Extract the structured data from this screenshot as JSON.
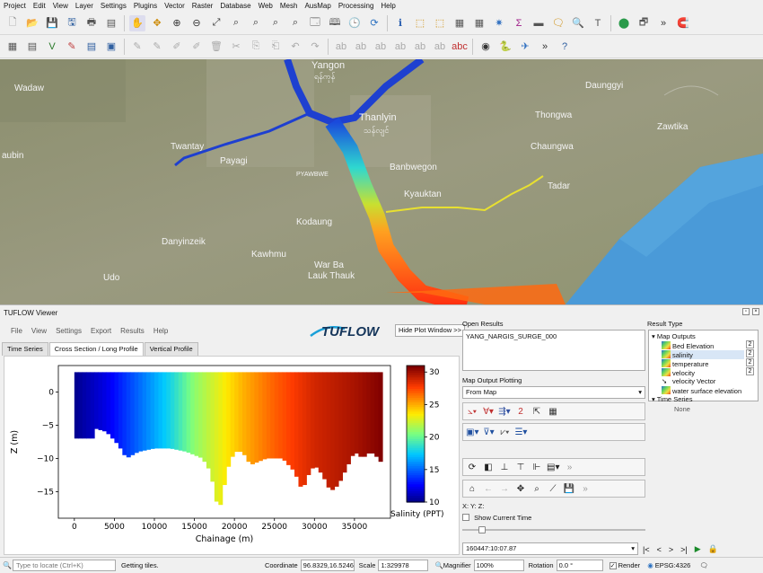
{
  "menu": [
    "Project",
    "Edit",
    "View",
    "Layer",
    "Settings",
    "Plugins",
    "Vector",
    "Raster",
    "Database",
    "Web",
    "Mesh",
    "AusMap",
    "Processing",
    "Help"
  ],
  "map": {
    "labels": {
      "yangon": "Yangon",
      "yangon_local": "ရန်ကုန်",
      "thanlyin": "Thanlyin",
      "thanlyin_local": "သန်လျင်",
      "daunggyi": "Daunggyi",
      "wadaw": "Wadaw",
      "twantay": "Twantay",
      "payagi": "Payagi",
      "thongwa": "Thongwa",
      "zawtika": "Zawtika",
      "chaungwa": "Chaungwa",
      "kaubin": "aubin",
      "pyawbwe": "PYAWBWE",
      "banbwegon": "Banbwegon",
      "tadar": "Tadar",
      "kyauktan": "Kyauktan",
      "kodaung": "Kodaung",
      "danyinzeik": "Danyinzeik",
      "kawhmu": "Kawhmu",
      "warba1": "War Ba",
      "warba2": "Lauk Thauk",
      "udo": "Udo"
    }
  },
  "viewer": {
    "title": "TUFLOW Viewer",
    "menu": [
      "File",
      "View",
      "Settings",
      "Export",
      "Results",
      "Help"
    ],
    "logo_text": "TUFLOW",
    "hide_button": "Hide Plot Window >>",
    "tabs": [
      "Time Series",
      "Cross Section / Long Profile",
      "Vertical Profile"
    ]
  },
  "open_results": {
    "label": "Open Results",
    "items": [
      "YANG_NARGIS_SURGE_000"
    ]
  },
  "map_output_plotting": {
    "label": "Map Output Plotting",
    "selected": "From Map"
  },
  "xyz_label": "X:  Y:  Z:",
  "show_current_time": "Show Current Time",
  "current_time": "160447:10:07.87",
  "result_type": {
    "label": "Result Type",
    "map_outputs": "Map Outputs",
    "items": [
      "Bed Elevation",
      "salinity",
      "temperature",
      "velocity",
      "velocity Vector",
      "water surface elevation"
    ],
    "time_series": "Time Series",
    "none": "None"
  },
  "chart_data": {
    "type": "heatmap",
    "xlabel": "Chainage (m)",
    "ylabel": "Z (m)",
    "colorbar_label": "Salinity (PPT)",
    "xlim": [
      -2000,
      39500
    ],
    "ylim": [
      -19,
      4
    ],
    "xticks": [
      0,
      5000,
      10000,
      15000,
      20000,
      25000,
      30000,
      35000
    ],
    "yticks": [
      0,
      -5,
      -10,
      -15
    ],
    "colorbar_ticks": [
      10,
      15,
      20,
      25,
      30
    ],
    "colorbar_range": [
      10,
      31
    ],
    "top_z": 3,
    "bed_profile": {
      "chainage": [
        0,
        2500,
        2600,
        4000,
        5500,
        6500,
        8000,
        10000,
        12000,
        14000,
        15000,
        16000,
        17000,
        17500,
        18000,
        18500,
        19000,
        20000,
        21000,
        22000,
        24000,
        26000,
        27500,
        28500,
        29000,
        30000,
        31000,
        32000,
        33000,
        34000,
        35000,
        36000,
        37000,
        38000,
        38500
      ],
      "z": [
        -7,
        -7,
        -5.5,
        -6,
        -8,
        -10,
        -9,
        -8.5,
        -8.5,
        -9,
        -9.5,
        -10,
        -12,
        -15,
        -18,
        -16,
        -12,
        -9,
        -9,
        -11,
        -10,
        -10,
        -12,
        -15,
        -13,
        -11,
        -12.5,
        -15,
        -14,
        -11.5,
        -9,
        -10,
        -9,
        -10,
        -11
      ]
    },
    "salinity_profile": {
      "chainage": [
        0,
        4000,
        8000,
        12000,
        15000,
        18000,
        21000,
        25000,
        30000,
        35000,
        38500
      ],
      "salinity": [
        10,
        12,
        15,
        18,
        21,
        23,
        25,
        27,
        29,
        30,
        31
      ]
    }
  },
  "status": {
    "locate_placeholder": "Type to locate (Ctrl+K)",
    "message": "Getting tiles.",
    "coordinate_label": "Coordinate",
    "coordinate": "96.8329,16.5246",
    "scale_label": "Scale",
    "scale": "1:329978",
    "magnifier_label": "Magnifier",
    "magnifier": "100%",
    "rotation_label": "Rotation",
    "rotation": "0.0 °",
    "render_label": "Render",
    "crs": "EPSG:4326"
  }
}
